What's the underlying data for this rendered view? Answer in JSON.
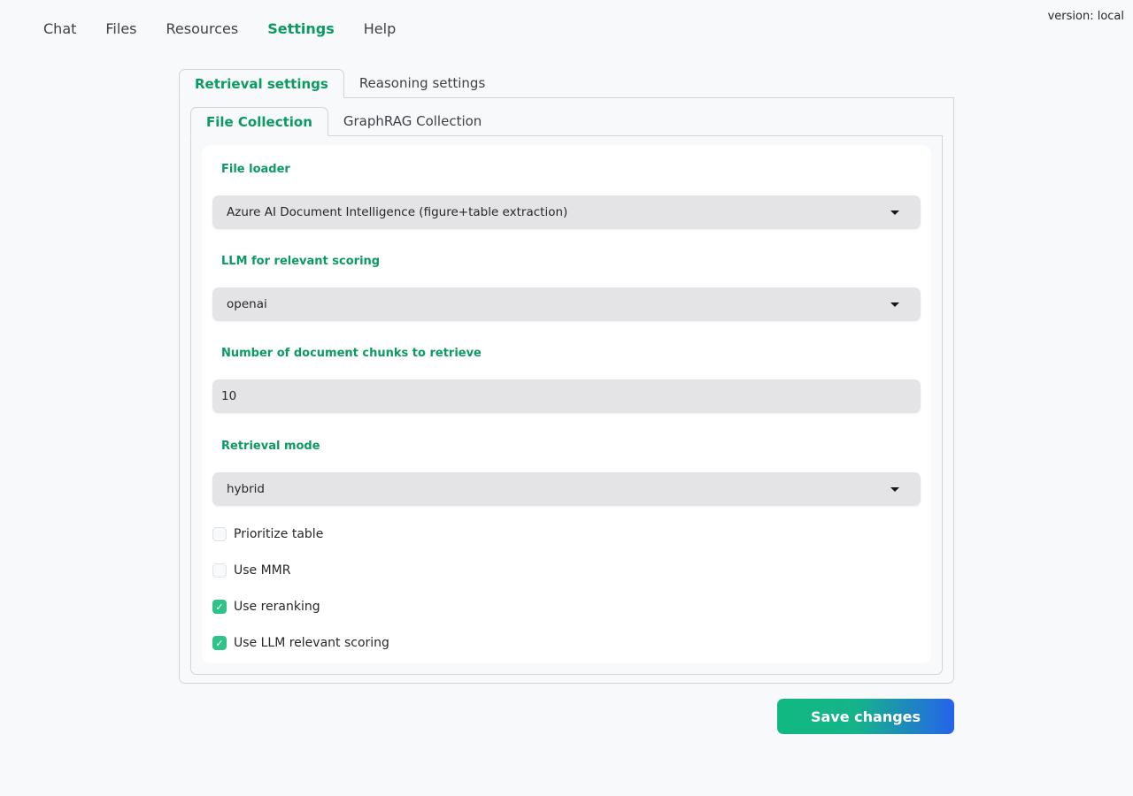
{
  "nav": {
    "items": [
      {
        "label": "Chat"
      },
      {
        "label": "Files"
      },
      {
        "label": "Resources"
      },
      {
        "label": "Settings",
        "active": true
      },
      {
        "label": "Help"
      }
    ],
    "version": "version: local"
  },
  "settings": {
    "tabs": [
      {
        "label": "Retrieval settings",
        "active": true
      },
      {
        "label": "Reasoning settings"
      }
    ],
    "subtabs": [
      {
        "label": "File Collection",
        "active": true
      },
      {
        "label": "GraphRAG Collection"
      }
    ],
    "file_loader": {
      "label": "File loader",
      "value": "Azure AI Document Intelligence (figure+table extraction)"
    },
    "llm_scoring": {
      "label": "LLM for relevant scoring",
      "value": "openai"
    },
    "num_chunks": {
      "label": "Number of document chunks to retrieve",
      "value": "10"
    },
    "retrieval_mode": {
      "label": "Retrieval mode",
      "value": "hybrid"
    },
    "checkboxes": [
      {
        "label": "Prioritize table",
        "checked": false
      },
      {
        "label": "Use MMR",
        "checked": false
      },
      {
        "label": "Use reranking",
        "checked": true
      },
      {
        "label": "Use LLM relevant scoring",
        "checked": true
      }
    ]
  },
  "actions": {
    "save_label": "Save changes"
  },
  "colors": {
    "accent": "#0c9a63",
    "checkbox_on": "#2fc38a",
    "button_gradient_start": "#10b981",
    "button_gradient_end": "#2563eb"
  }
}
